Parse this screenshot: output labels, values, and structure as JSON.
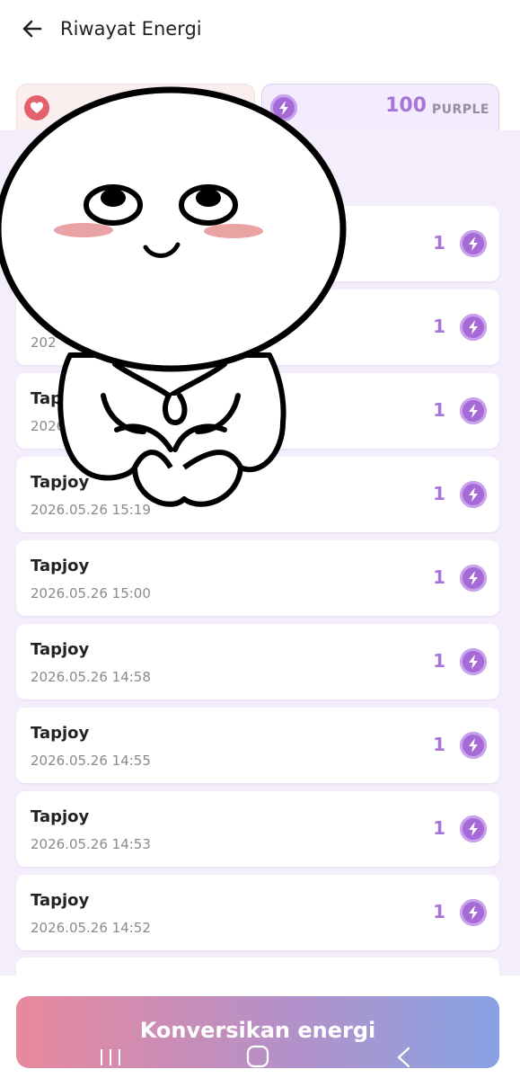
{
  "header": {
    "title": "Riwayat Energi",
    "back_icon": "arrow-left-icon"
  },
  "tabs": {
    "heart": {
      "icon": "heart-icon"
    },
    "purple": {
      "icon": "lightning-icon",
      "amount": "100",
      "unit": "PURPLE"
    }
  },
  "rows": [
    {
      "name": "",
      "date": "",
      "amount": "1"
    },
    {
      "name": "",
      "date": "202",
      "amount": "1"
    },
    {
      "name": "Tapj",
      "date": "2026",
      "amount": "1"
    },
    {
      "name": "Tapjoy",
      "date": "2026.05.26 15:19",
      "amount": "1"
    },
    {
      "name": "Tapjoy",
      "date": "2026.05.26 15:00",
      "amount": "1"
    },
    {
      "name": "Tapjoy",
      "date": "2026.05.26 14:58",
      "amount": "1"
    },
    {
      "name": "Tapjoy",
      "date": "2026.05.26 14:55",
      "amount": "1"
    },
    {
      "name": "Tapjoy",
      "date": "2026.05.26 14:53",
      "amount": "1"
    },
    {
      "name": "Tapjoy",
      "date": "2026.05.26 14:52",
      "amount": "1"
    }
  ],
  "convert_button": {
    "label": "Konversikan energi"
  },
  "colors": {
    "accent": "#a774d8",
    "list_bg": "#f3edfc",
    "heart": "#e4606b"
  }
}
